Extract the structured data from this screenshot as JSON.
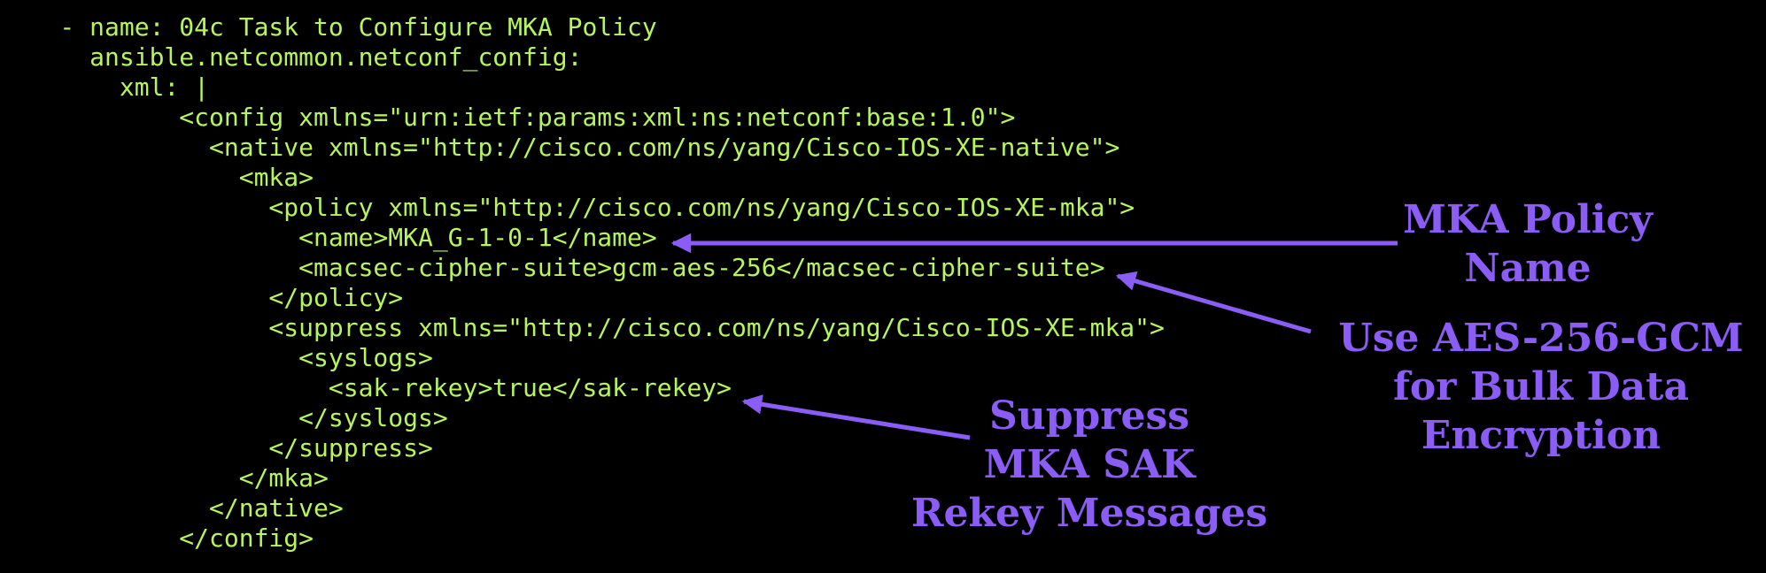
{
  "code_lines": [
    "    - name: 04c Task to Configure MKA Policy",
    "      ansible.netcommon.netconf_config:",
    "        xml: |",
    "            <config xmlns=\"urn:ietf:params:xml:ns:netconf:base:1.0\">",
    "              <native xmlns=\"http://cisco.com/ns/yang/Cisco-IOS-XE-native\">",
    "                <mka>",
    "                  <policy xmlns=\"http://cisco.com/ns/yang/Cisco-IOS-XE-mka\">",
    "                    <name>MKA_G-1-0-1</name>",
    "                    <macsec-cipher-suite>gcm-aes-256</macsec-cipher-suite>",
    "                  </policy>",
    "                  <suppress xmlns=\"http://cisco.com/ns/yang/Cisco-IOS-XE-mka\">",
    "                    <syslogs>",
    "                      <sak-rekey>true</sak-rekey>",
    "                    </syslogs>",
    "                  </suppress>",
    "                </mka>",
    "              </native>",
    "            </config>"
  ],
  "annotations": {
    "policy_name": [
      "MKA Policy",
      "Name"
    ],
    "cipher": [
      "Use AES-256-GCM",
      "for Bulk Data",
      "Encryption"
    ],
    "suppress": [
      "Suppress",
      "MKA SAK",
      "Rekey Messages"
    ]
  },
  "colors": {
    "background": "#000000",
    "code_text": "#b6f55d",
    "annotation": "#8b5cf6"
  }
}
